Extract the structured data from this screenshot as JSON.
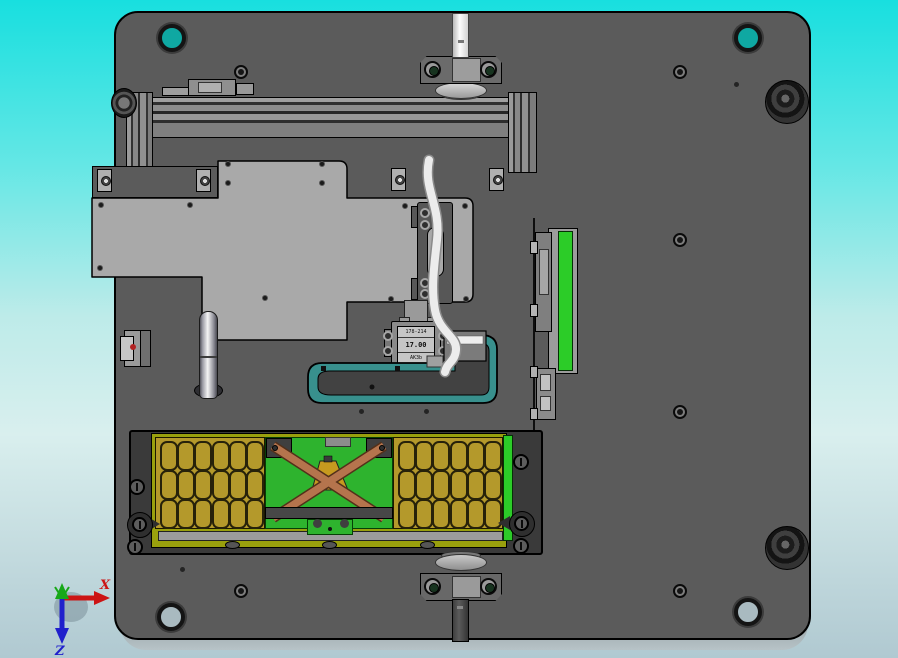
{
  "triad": {
    "x_label": "X",
    "z_label": "Z"
  },
  "gauge": {
    "line1": "178-214",
    "line2": "17.00",
    "line3": "AK3b"
  },
  "trays": {
    "rows": 3,
    "cols": 6
  },
  "colors": {
    "bg_top": "#18dfdf",
    "bg_mid": "#bdebe9",
    "bg_bottom": "#b0c9d1",
    "plate": "#5b5b5b",
    "subplate": "#a9a9a9",
    "teal_part": "#38908d",
    "tray_gold": "#b4992b",
    "tray_frame": "#99a00d",
    "board_green": "#2eb32e",
    "strap_copper": "#b5744d",
    "green_strip": "#2ccc28",
    "hole_teal": "#0fa8a2",
    "axis_x": "#cc1414",
    "axis_y": "#18a818",
    "axis_z": "#2020cc"
  }
}
